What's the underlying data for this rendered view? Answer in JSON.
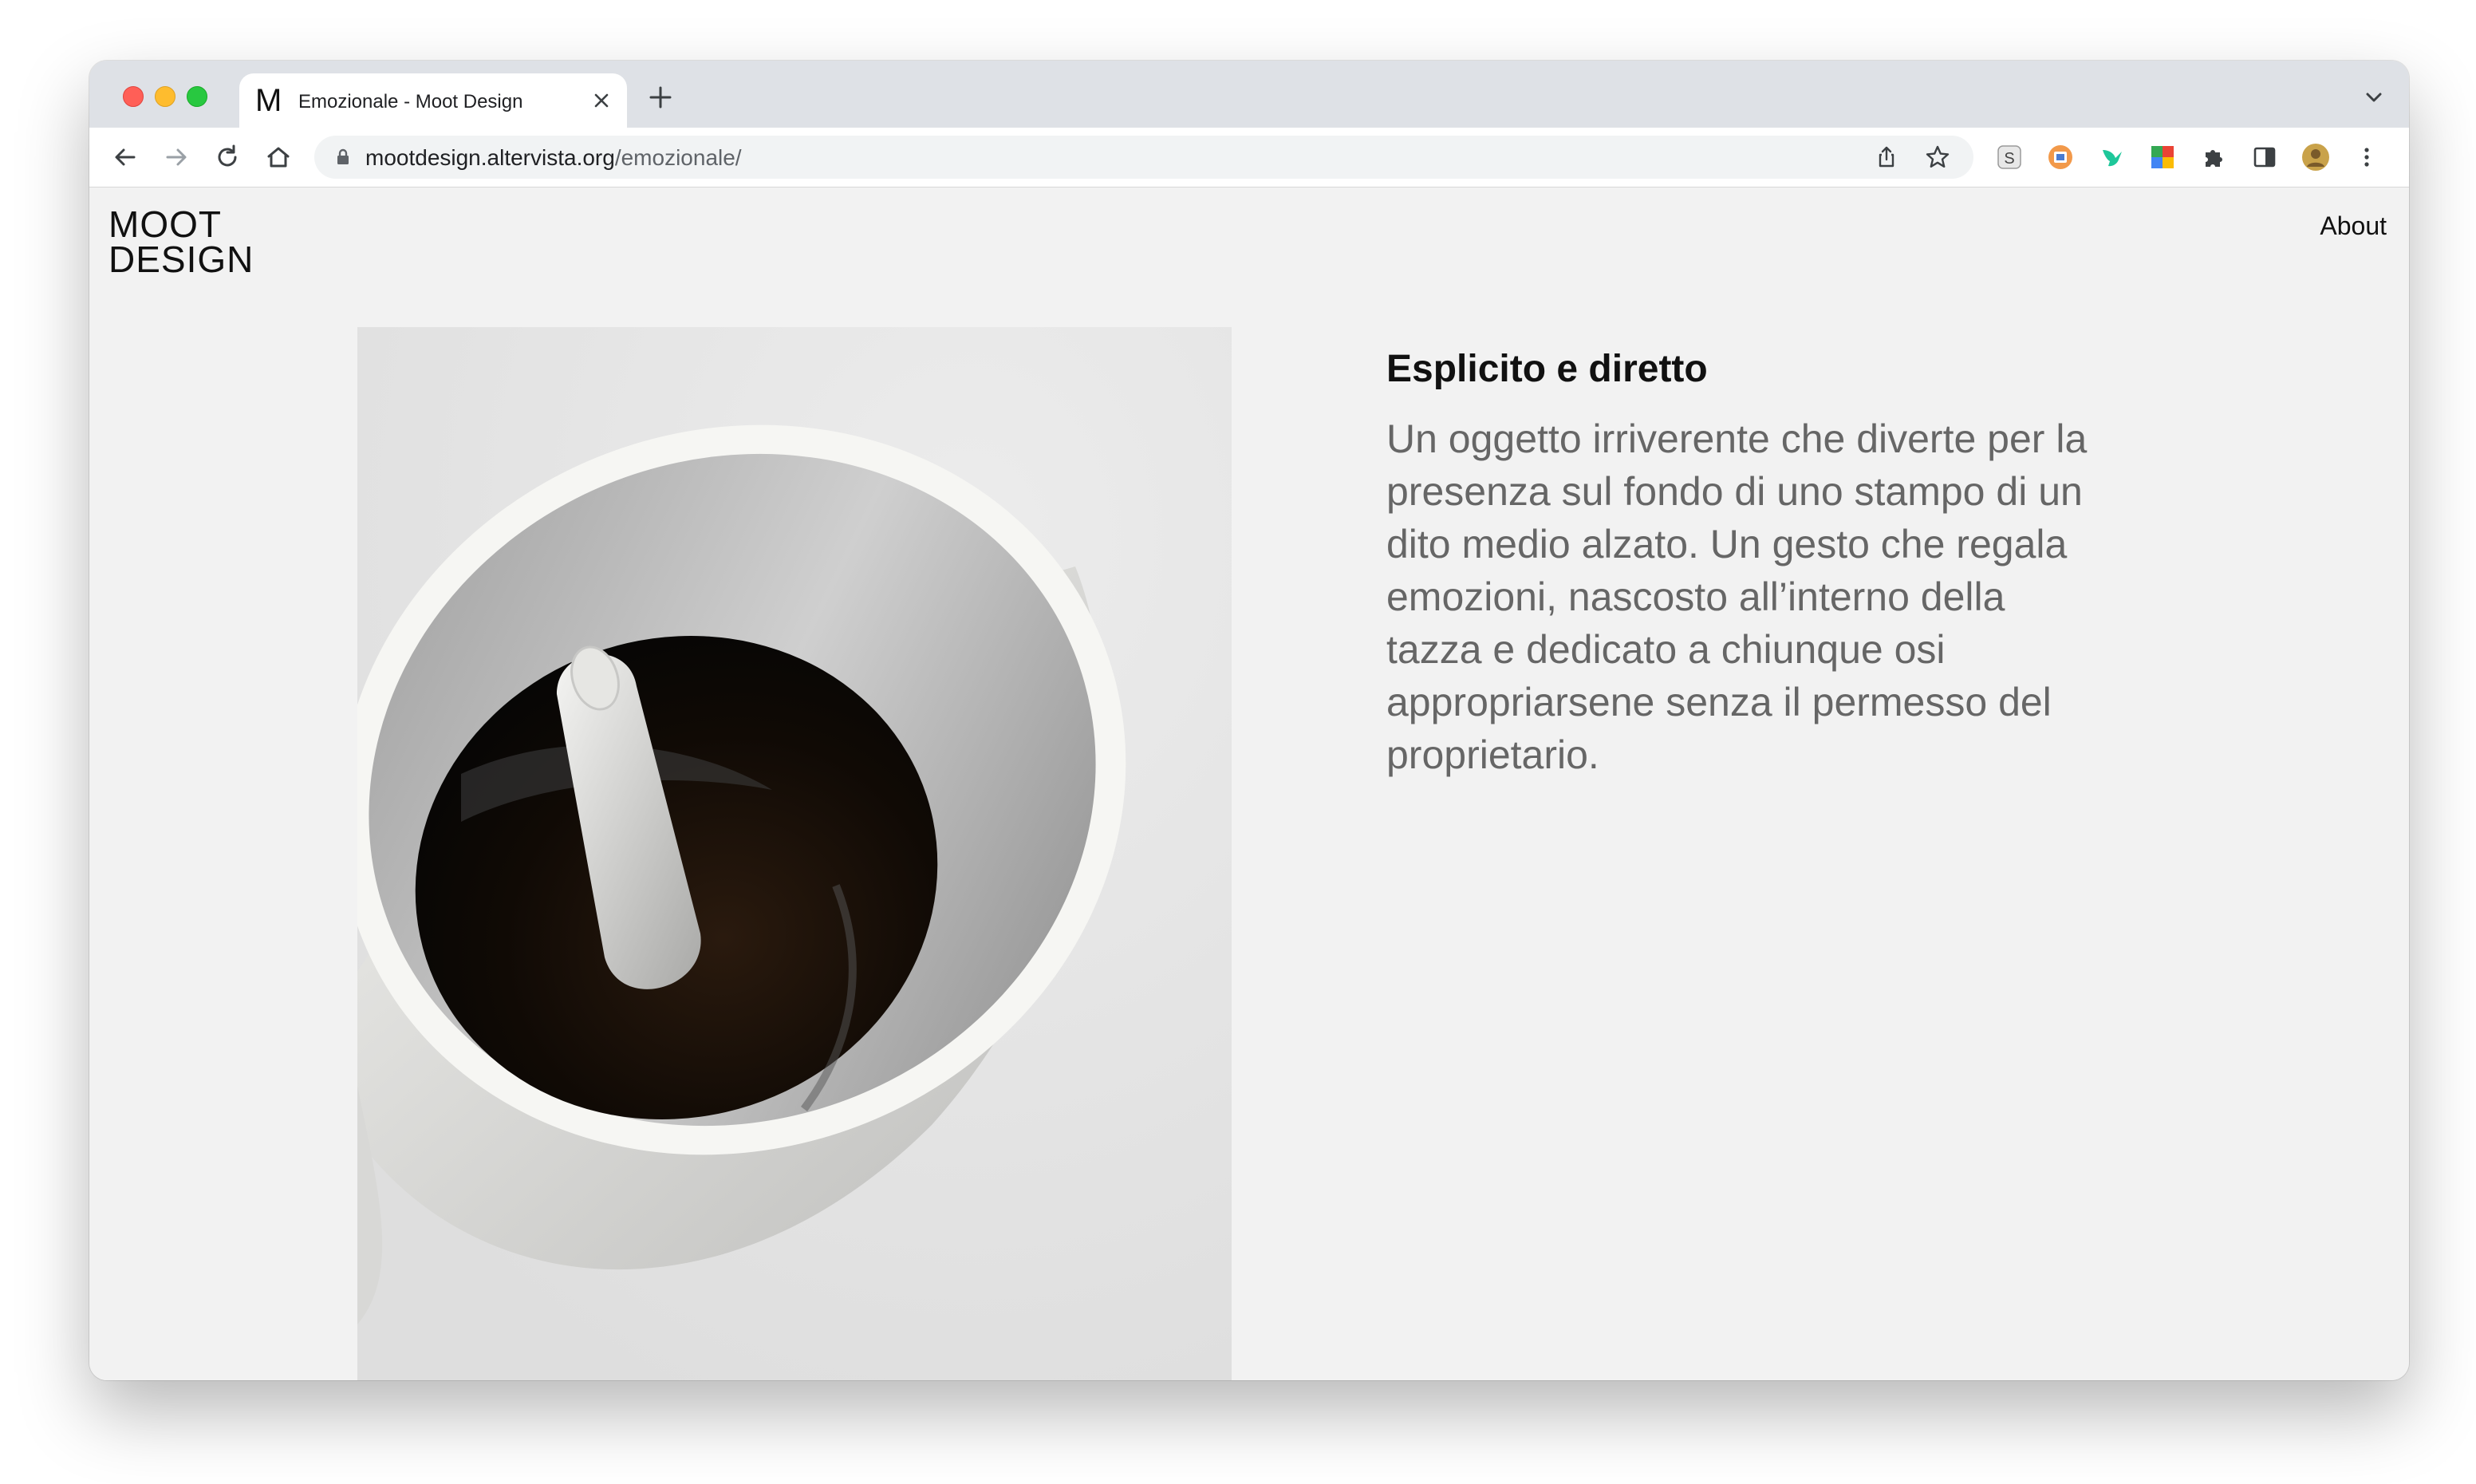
{
  "browser": {
    "tab": {
      "favicon": "M",
      "title": "Emozionale - Moot Design",
      "close_icon": "close-icon"
    },
    "new_tab_icon": "plus-icon",
    "tab_menu_icon": "chevron-down-icon",
    "toolbar": {
      "back_icon": "arrow-left-icon",
      "forward_icon": "arrow-right-icon",
      "reload_icon": "reload-icon",
      "home_icon": "home-icon",
      "url_domain": "mootdesign.altervista.org",
      "url_path": "/emozionale/",
      "share_icon": "share-icon",
      "bookmark_icon": "star-icon",
      "extensions": [
        "s-extension-icon",
        "screen-capture-extension-icon",
        "hummingbird-extension-icon",
        "grid-extension-icon",
        "puzzle-icon",
        "side-panel-icon",
        "profile-avatar",
        "kebab-menu-icon"
      ]
    }
  },
  "site": {
    "logo_line1": "MOOT",
    "logo_line2": "DESIGN",
    "nav_about": "About"
  },
  "product": {
    "heading": "Esplicito e diretto",
    "description": "Un oggetto irriverente che diverte per la presenza sul fondo di uno stampo di un dito medio alzato. Un gesto che regala emozioni, nascosto all’interno della tazza e dedicato a chiunque osi appropriarsene senza il permesso del proprietario."
  },
  "colors": {
    "page_background": "#f2f2f2",
    "text_primary": "#111111",
    "text_secondary": "#666666",
    "tab_strip": "#dee1e6"
  }
}
